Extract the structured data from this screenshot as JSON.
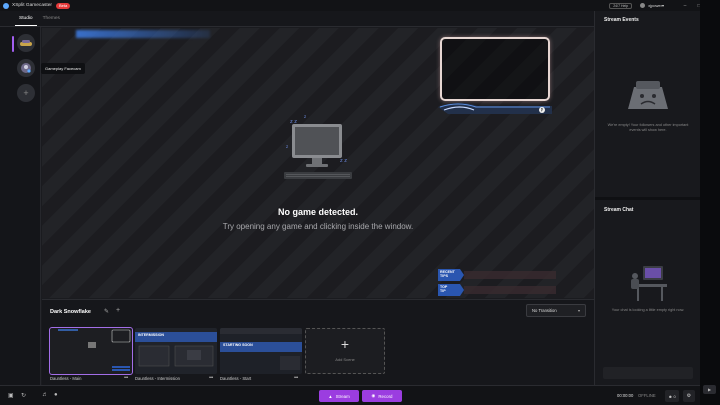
{
  "titlebar": {
    "app_name": "XSplit Gamecaster",
    "beta_label": "Beta",
    "help_label": "24/7 Help",
    "user_name": "xjpower",
    "min_icon": "minimize-icon",
    "max_icon": "maximize-icon",
    "close_icon": "close-icon"
  },
  "tabs": [
    {
      "label": "Studio",
      "active": true
    },
    {
      "label": "Themes",
      "active": false
    }
  ],
  "rail": {
    "tooltip": "Gameplay Facecam"
  },
  "preview": {
    "title": "No game detected.",
    "subtitle": "Try opening any game and clicking inside the window.",
    "tip_recent": "RECENT\nTIPS",
    "tip_top": "TOP\nTIP"
  },
  "stream_events": {
    "title": "Stream Events",
    "empty_text": "We're empty! Your followers and other important events will show here."
  },
  "stream_chat": {
    "title": "Stream Chat",
    "empty_text": "Your chat is looking a little empty right now."
  },
  "scenes": {
    "theme_name": "Dark Snowflake",
    "transition": "No Transition",
    "items": [
      {
        "label": "Dauntless - Main",
        "selected": true
      },
      {
        "label": "Dauntless - Intermission",
        "selected": false
      },
      {
        "label": "Dauntless - Start",
        "selected": false
      }
    ],
    "add_label": "Add Scene",
    "thumb_intermission": "INTERMISSION",
    "thumb_starting": "STARTING SOON"
  },
  "bottom": {
    "stream_label": "Stream",
    "record_label": "Record",
    "timer": "00:00:00",
    "status": "OFFLINE",
    "viewers": "0"
  },
  "colors": {
    "accent": "#9b3de0",
    "beta": "#e43a3a",
    "brand_blue": "#3c78dc"
  }
}
